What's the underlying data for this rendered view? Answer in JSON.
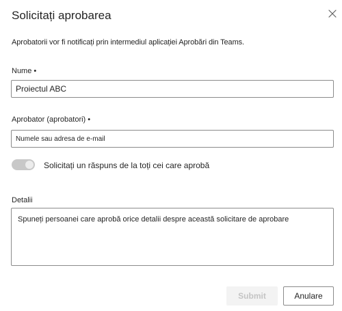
{
  "dialog": {
    "title": "Solicitați aprobarea",
    "close_icon": "close-icon",
    "description": "Aprobatorii vor fi notificați prin intermediul aplicației Aprobări din Teams."
  },
  "name_field": {
    "label": "Nume",
    "required_marker": "•",
    "value": "Proiectul ABC"
  },
  "approver_field": {
    "label": "Aprobator (aprobatori)",
    "required_marker": "•",
    "placeholder": "Numele sau adresa de e-mail"
  },
  "toggle": {
    "label": "Solicitați un răspuns de la toți cei care aprobă",
    "state": "on-disabled"
  },
  "details_field": {
    "label": "Detalii",
    "placeholder": "Spuneți persoanei care aprobă orice detalii despre această solicitare de aprobare"
  },
  "buttons": {
    "submit_label": "Submit",
    "cancel_label": "Anulare"
  },
  "colors": {
    "text": "#242424",
    "border": "#8a8a8a",
    "toggle_track": "#c8c8c8",
    "submit_disabled_bg": "#f3f3f3",
    "submit_disabled_text": "#c4c4c4"
  }
}
